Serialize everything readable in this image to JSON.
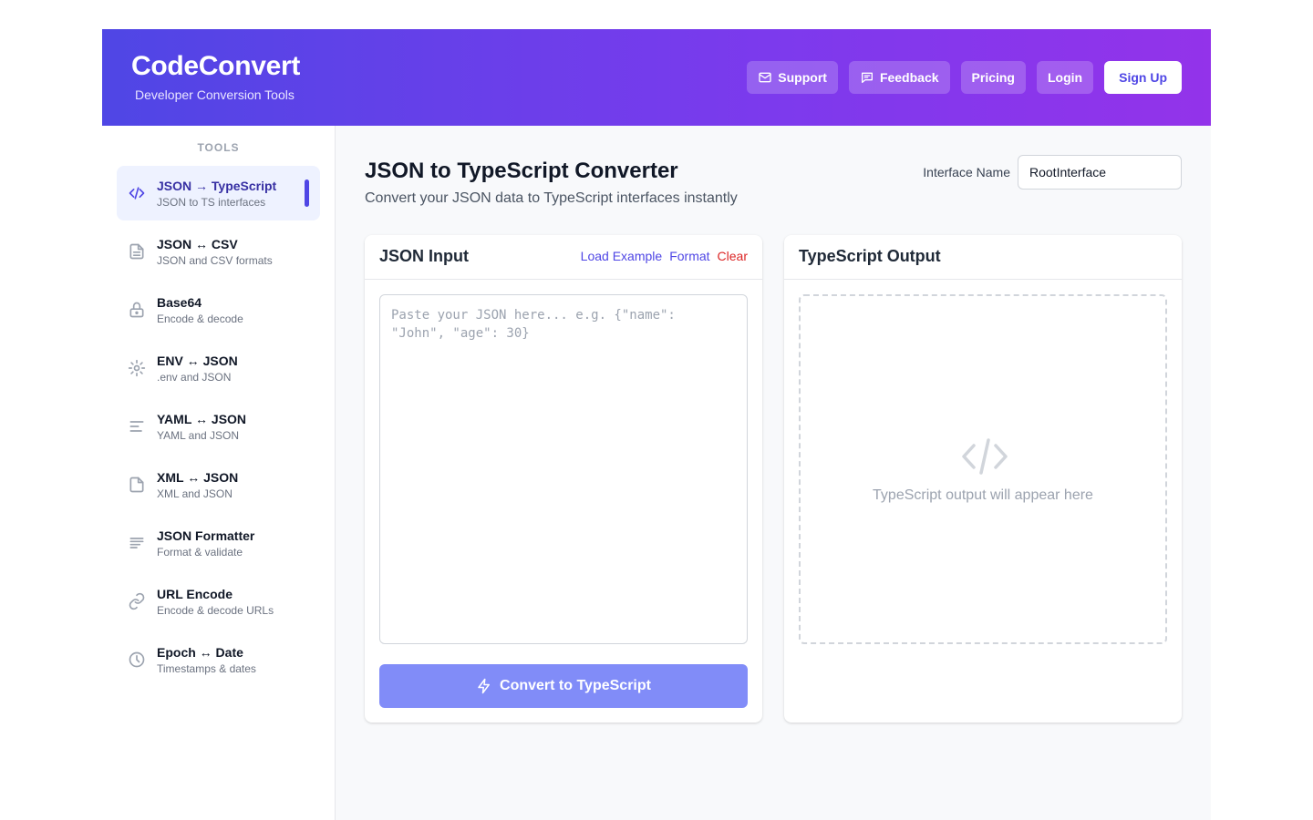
{
  "header": {
    "brand": "CodeConvert",
    "tagline": "Developer Conversion Tools",
    "nav": {
      "support": "Support",
      "feedback": "Feedback",
      "pricing": "Pricing",
      "login": "Login",
      "signup": "Sign Up"
    }
  },
  "sidebar": {
    "heading": "TOOLS",
    "items": [
      {
        "name": "JSON → TypeScript",
        "desc": "JSON to TS interfaces",
        "icon": "code-icon",
        "active": true
      },
      {
        "name": "JSON ↔ CSV",
        "desc": "JSON and CSV formats",
        "icon": "file-text-icon"
      },
      {
        "name": "Base64",
        "desc": "Encode & decode",
        "icon": "lock-icon"
      },
      {
        "name": "ENV ↔ JSON",
        "desc": ".env and JSON",
        "icon": "gear-icon"
      },
      {
        "name": "YAML ↔ JSON",
        "desc": "YAML and JSON",
        "icon": "align-left-icon"
      },
      {
        "name": "XML ↔ JSON",
        "desc": "XML and JSON",
        "icon": "file-icon"
      },
      {
        "name": "JSON Formatter",
        "desc": "Format & validate",
        "icon": "lines-icon"
      },
      {
        "name": "URL Encode",
        "desc": "Encode & decode URLs",
        "icon": "link-icon"
      },
      {
        "name": "Epoch ↔ Date",
        "desc": "Timestamps & dates",
        "icon": "clock-icon"
      }
    ]
  },
  "main": {
    "title": "JSON to TypeScript Converter",
    "subtitle": "Convert your JSON data to TypeScript interfaces instantly",
    "interface_label": "Interface Name",
    "interface_value": "RootInterface",
    "input_panel": {
      "title": "JSON Input",
      "load_example": "Load Example",
      "format": "Format",
      "clear": "Clear",
      "placeholder": "Paste your JSON here... e.g. {\"name\": \"John\", \"age\": 30}",
      "value": ""
    },
    "convert_button": "Convert to TypeScript",
    "output_panel": {
      "title": "TypeScript Output",
      "empty_text": "TypeScript output will appear here"
    }
  },
  "colors": {
    "accent": "#4f46e5",
    "header_gradient_start": "#4f46e5",
    "header_gradient_end": "#9333ea",
    "danger": "#dc2626",
    "convert_button": "#818cf8"
  }
}
